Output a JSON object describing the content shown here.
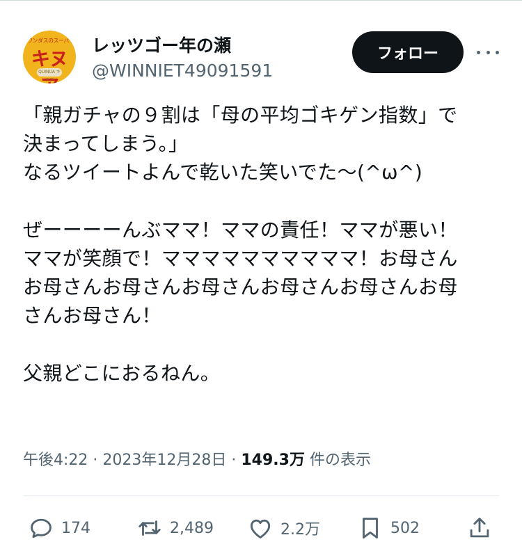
{
  "author": {
    "display_name": "レッツゴー年の瀬",
    "handle": "@WINNIET49091591",
    "avatar": {
      "top_text": "ワンダスのスーパーマーケット",
      "main_text": "キヌア",
      "sub_text": "QUINUA キヌア",
      "bg_color": "#f2b41c"
    }
  },
  "follow_button": {
    "label": "フォロー"
  },
  "tweet": {
    "text": "「親ガチャの９割は「母の平均ゴキゲン指数」で\n決まってしまう。」\nなるツイートよんで乾いた笑いでた〜(^ω^)\n\nぜーーーーんぶママ！ママの責任！ママが悪い！\nママが笑顔で！ママママママママママ！お母さん\nお母さんお母さんお母さんお母さんお母さんお母\nさんお母さん！\n\n父親どこにおるねん。"
  },
  "meta": {
    "time": "午後4:22",
    "sep1": " · ",
    "date": "2023年12月28日",
    "sep2": " · ",
    "views_count": "149.3万",
    "views_label": " 件の表示"
  },
  "actions": {
    "replies": "174",
    "retweets": "2,489",
    "likes": "2.2万",
    "bookmarks": "502"
  },
  "colors": {
    "text_primary": "#0f1419",
    "text_secondary": "#536471",
    "button_bg": "#0f1419"
  }
}
